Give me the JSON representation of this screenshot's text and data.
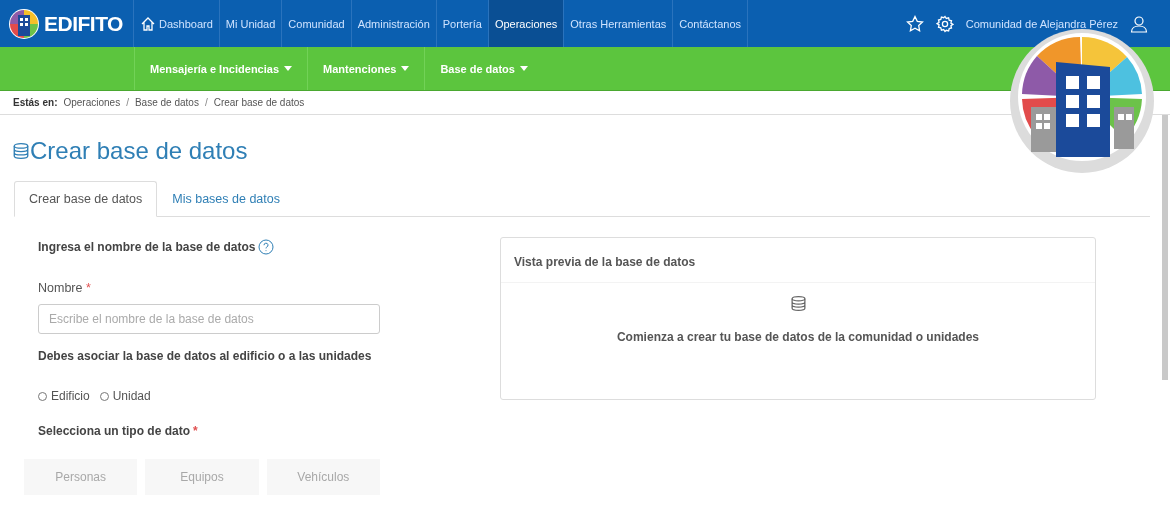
{
  "brand": {
    "name": "EDIFITO"
  },
  "nav": [
    {
      "label": "Dashboard",
      "selected": false
    },
    {
      "label": "Mi Unidad",
      "selected": false
    },
    {
      "label": "Comunidad",
      "selected": false
    },
    {
      "label": "Administración",
      "selected": false
    },
    {
      "label": "Portería",
      "selected": false
    },
    {
      "label": "Operaciones",
      "selected": true
    },
    {
      "label": "Otras Herramientas",
      "selected": false
    },
    {
      "label": "Contáctanos",
      "selected": false
    }
  ],
  "user": {
    "name": "Comunidad de Alejandra Pérez"
  },
  "subnav": [
    "Mensajería e Incidencias",
    "Mantenciones",
    "Base de datos"
  ],
  "breadcrumb": {
    "label": "Estás en:",
    "separator": "/",
    "items": [
      "Operaciones",
      "Base de datos",
      "Crear base de datos"
    ]
  },
  "page_title": "Crear base de datos",
  "tabs": [
    {
      "label": "Crear base de datos",
      "selected": true
    },
    {
      "label": "Mis bases de datos",
      "selected": false
    }
  ],
  "form": {
    "heading": "Ingresa el nombre de la base de datos",
    "name_label": "Nombre",
    "required_mark": "*",
    "name_placeholder": "Escribe el nombre de la base de datos",
    "associate_label": "Debes asociar la base de datos al edificio o a las unidades",
    "association": [
      {
        "label": "Edificio",
        "selected": false
      },
      {
        "label": "Unidad",
        "selected": false
      }
    ],
    "type_label": "Selecciona un tipo de dato",
    "type_required_mark": "*",
    "types": [
      {
        "label": "Personas",
        "disabled": true
      },
      {
        "label": "Equipos",
        "disabled": true
      },
      {
        "label": "Vehículos",
        "disabled": true
      }
    ]
  },
  "preview": {
    "title": "Vista previa de la base de datos",
    "message": "Comienza a crear tu base de datos de la comunidad o unidades"
  }
}
